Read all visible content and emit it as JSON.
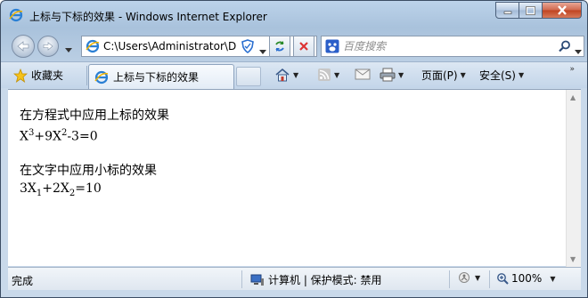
{
  "window": {
    "title": "上标与下标的效果 - Windows Internet Explorer"
  },
  "address_bar": {
    "url": "C:\\Users\\Administrator\\D"
  },
  "search": {
    "placeholder": "百度搜索"
  },
  "tabs": {
    "favorites_label": "收藏夹",
    "active_tab_label": "上标与下标的效果"
  },
  "commands": {
    "page_label": "页面(P)",
    "safety_label": "安全(S)"
  },
  "content": {
    "heading1": "在方程式中应用上标的效果",
    "eq1": {
      "a": "X",
      "a_sup": "3",
      "b": "+9X",
      "b_sup": "2",
      "c": "-3=0"
    },
    "heading2": "在文字中应用小标的效果",
    "eq2": {
      "a": "3X",
      "a_sub": "1",
      "b": "+2X",
      "b_sub": "2",
      "c": "=10"
    }
  },
  "status": {
    "text": "完成",
    "zone": "计算机 | 保护模式: 禁用",
    "zoom": "100%"
  },
  "colors": {
    "title_bar": "#bcd3ea",
    "close_button": "#c0431f",
    "content_bg": "#ffffff"
  }
}
